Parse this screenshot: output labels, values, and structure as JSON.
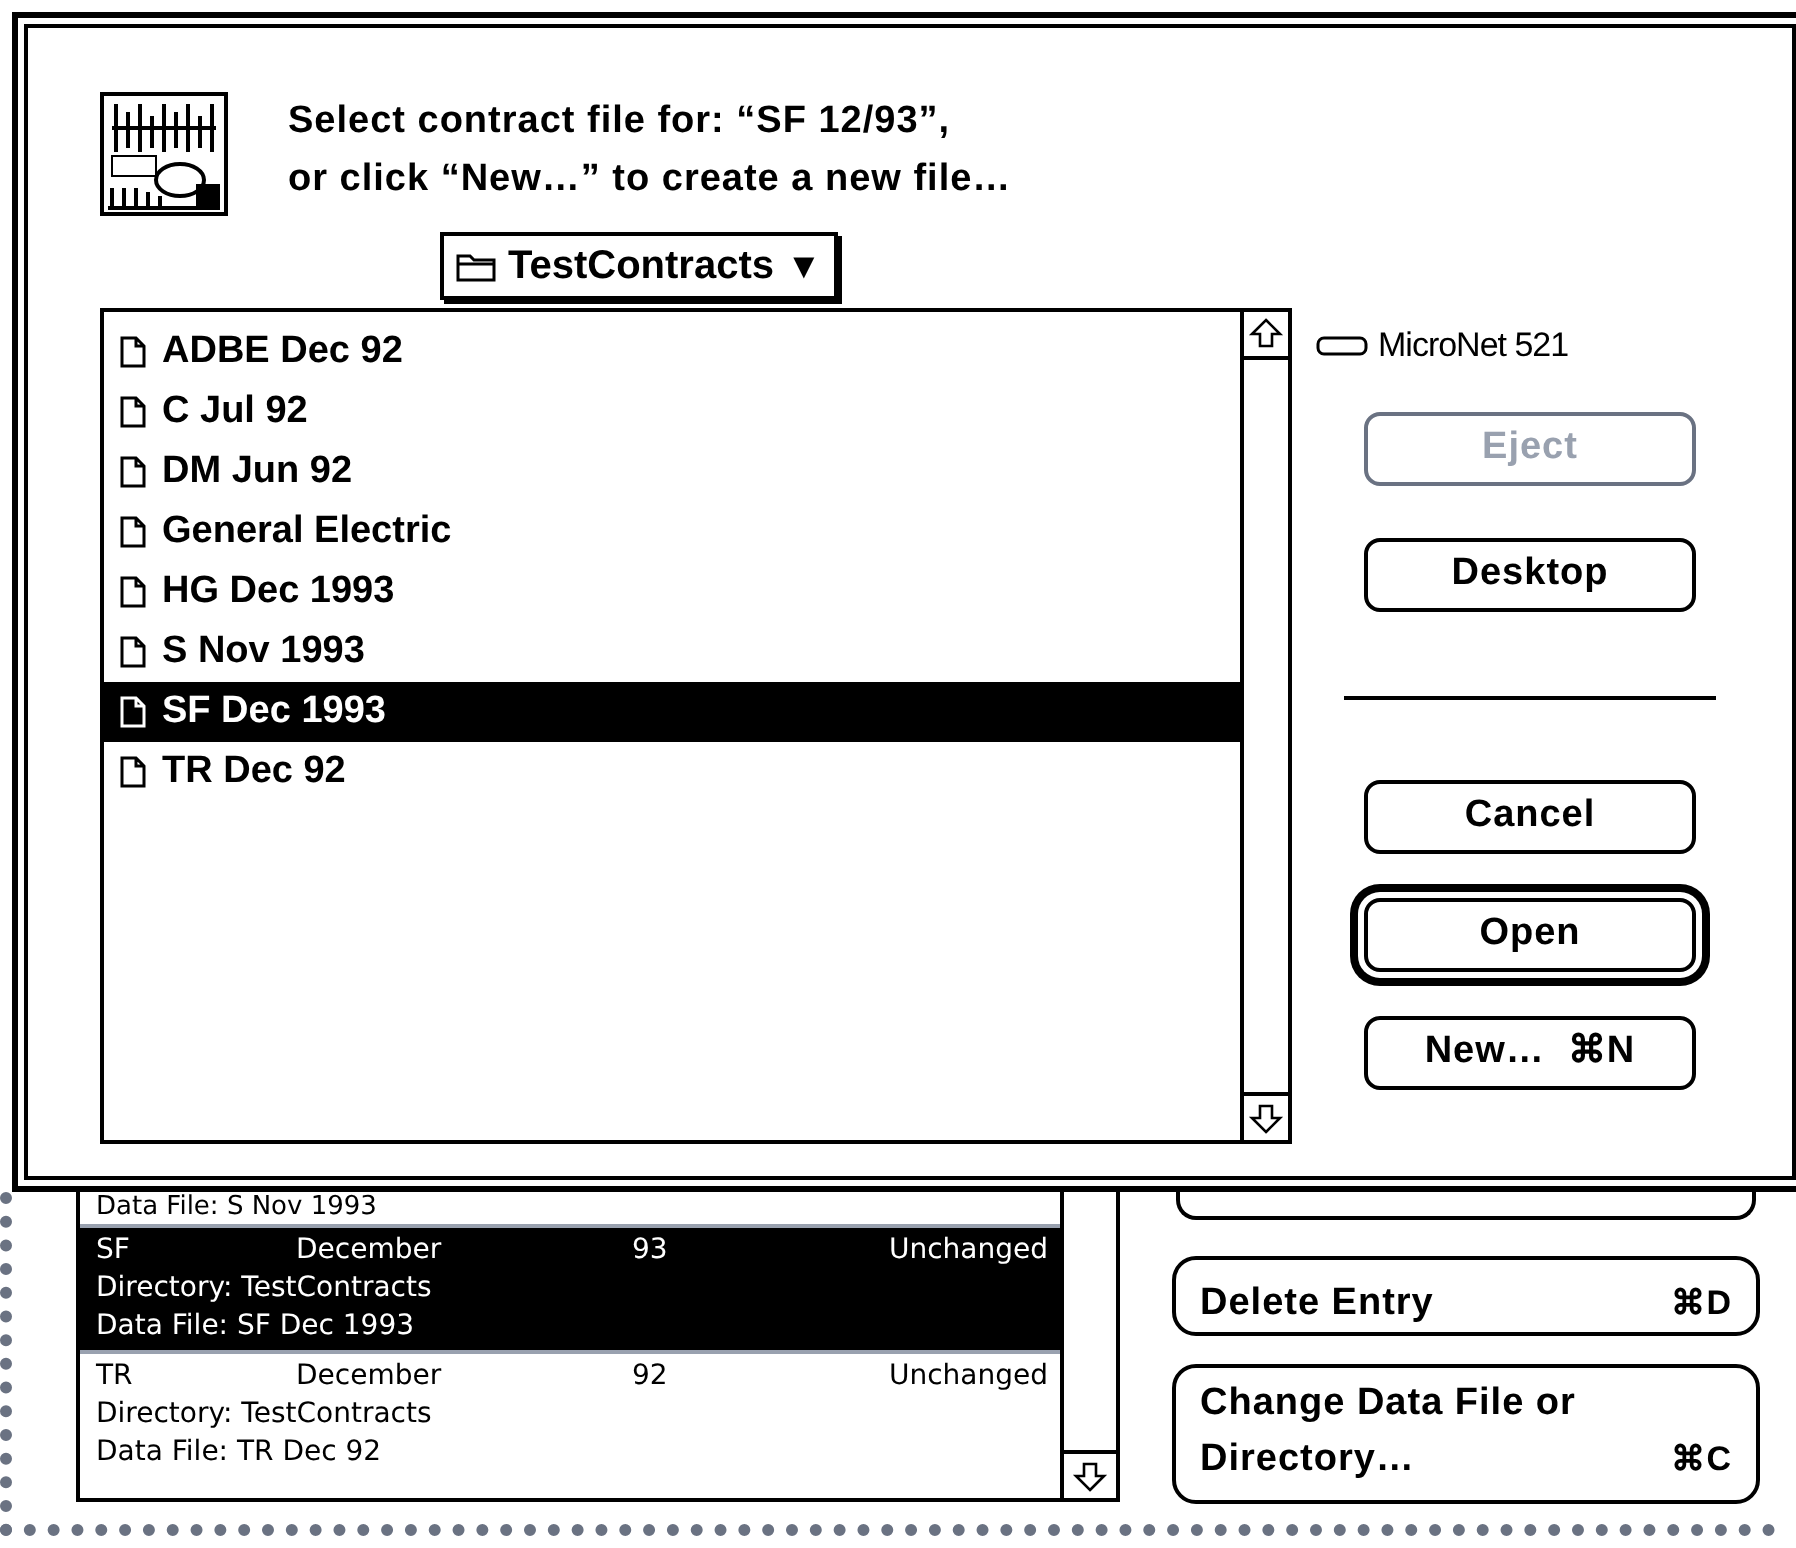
{
  "dialog": {
    "prompt_lines": [
      "Select contract file for: “SF 12/93”,",
      "or click “New…” to create a new file…"
    ],
    "folder_popup": {
      "label": "TestContracts",
      "arrow": "▼"
    },
    "files": [
      {
        "name": "ADBE Dec 92",
        "selected": false
      },
      {
        "name": "C Jul 92",
        "selected": false
      },
      {
        "name": "DM Jun 92",
        "selected": false
      },
      {
        "name": "General Electric",
        "selected": false
      },
      {
        "name": "HG Dec 1993",
        "selected": false
      },
      {
        "name": "S Nov 1993",
        "selected": false
      },
      {
        "name": "SF Dec 1993",
        "selected": true
      },
      {
        "name": "TR Dec 92",
        "selected": false
      }
    ],
    "drive": "MicroNet 521",
    "buttons_top": [
      {
        "label": "Eject",
        "disabled": true,
        "default": false
      },
      {
        "label": "Desktop",
        "disabled": false,
        "default": false
      }
    ],
    "buttons_bottom": [
      {
        "label": "Cancel",
        "disabled": false,
        "default": false
      },
      {
        "label": "Open",
        "disabled": false,
        "default": true
      },
      {
        "label": "New…  ⌘N",
        "disabled": false,
        "default": false
      }
    ]
  },
  "background_window": {
    "partial_line": "Data File: S Nov 1993",
    "entries": [
      {
        "code": "SF",
        "month": "December",
        "year": "93",
        "status": "Unchanged",
        "directory": "Directory: TestContracts",
        "data_file": "Data File: SF Dec 1993",
        "selected": true
      },
      {
        "code": "TR",
        "month": "December",
        "year": "92",
        "status": "Unchanged",
        "directory": "Directory: TestContracts",
        "data_file": "Data File: TR Dec 92",
        "selected": false
      }
    ],
    "buttons": [
      {
        "label": "Delete Entry",
        "shortcut": "⌘D"
      },
      {
        "label": "Change Data File or",
        "label_line2": "Directory…",
        "shortcut": "⌘C"
      }
    ]
  }
}
